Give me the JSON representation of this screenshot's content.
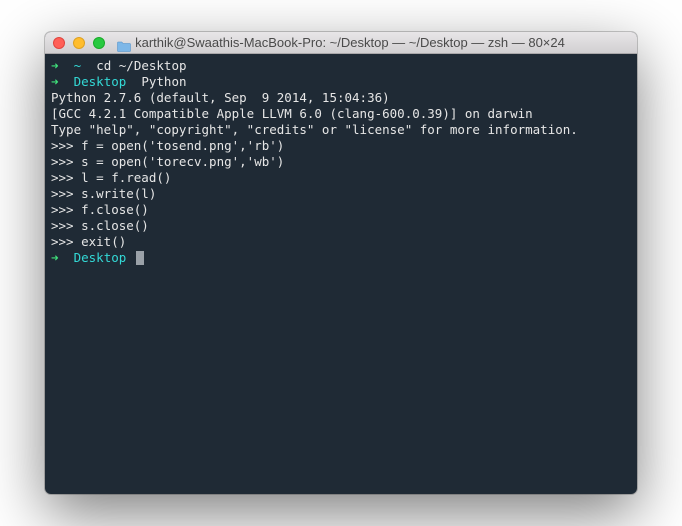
{
  "window": {
    "title": "karthik@Swaathis-MacBook-Pro: ~/Desktop — ~/Desktop — zsh — 80×24"
  },
  "prompt": {
    "arrow": "➜",
    "tilde": "~",
    "desktop": "Desktop"
  },
  "lines": {
    "cd": "cd ~/Desktop",
    "python": "Python",
    "ver": "Python 2.7.6 (default, Sep  9 2014, 15:04:36)",
    "gcc": "[GCC 4.2.1 Compatible Apple LLVM 6.0 (clang-600.0.39)] on darwin",
    "help": "Type \"help\", \"copyright\", \"credits\" or \"license\" for more information.",
    "p1": ">>> f = open('tosend.png','rb')",
    "p2": ">>> s = open('torecv.png','wb')",
    "p3": ">>> l = f.read()",
    "p4": ">>> s.write(l)",
    "p5": ">>> f.close()",
    "p6": ">>> s.close()",
    "p7": ">>> exit()"
  }
}
